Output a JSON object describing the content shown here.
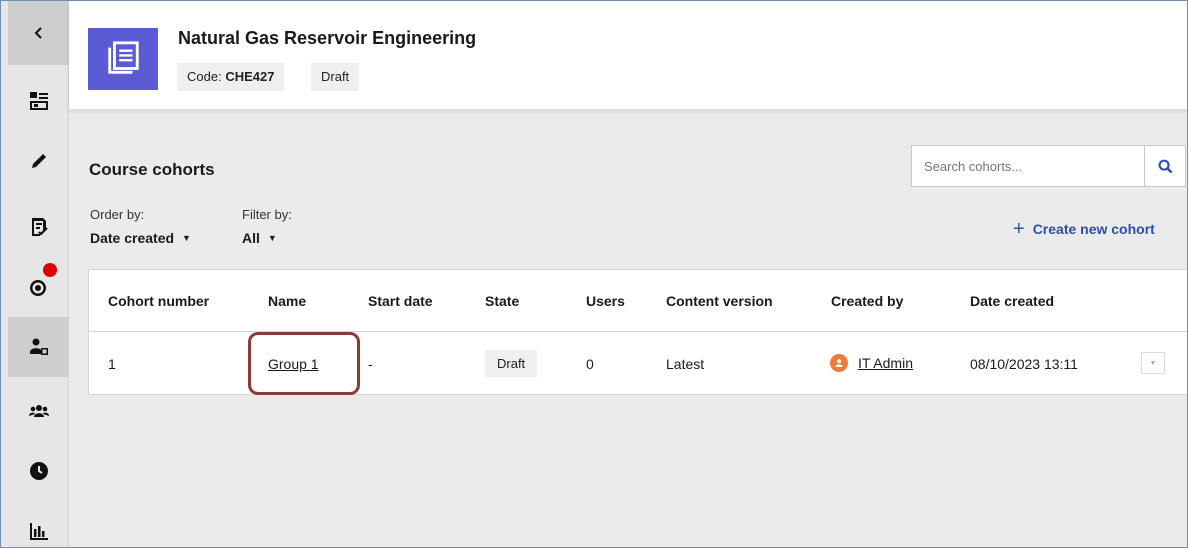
{
  "header": {
    "course_title": "Natural Gas Reservoir Engineering",
    "code_label": "Code: ",
    "code_value": "CHE427",
    "status": "Draft"
  },
  "main": {
    "section_title": "Course cohorts",
    "search": {
      "placeholder": "Search cohorts..."
    },
    "order_by": {
      "label": "Order by:",
      "value": "Date created"
    },
    "filter_by": {
      "label": "Filter by:",
      "value": "All"
    },
    "create_label": "Create new cohort"
  },
  "table": {
    "columns": [
      "Cohort number",
      "Name",
      "Start date",
      "State",
      "Users",
      "Content version",
      "Created by",
      "Date created"
    ],
    "rows": [
      {
        "cohort_number": "1",
        "name": "Group 1",
        "start_date": "-",
        "state": "Draft",
        "users": "0",
        "content_version": "Latest",
        "created_by": "IT Admin",
        "date_created": "08/10/2023 13:11"
      }
    ]
  },
  "colors": {
    "course_icon": "#5b5bd6",
    "notification_dot": "#e00000",
    "link_accent": "#2b4fa8",
    "highlight_border": "#8b3a3a",
    "avatar": "#f07a3a"
  },
  "icons": {
    "sidebar": [
      "chevron-left-icon",
      "dashboard-icon",
      "pencil-icon",
      "checklist-icon",
      "target-icon",
      "cohort-user-icon",
      "group-icon",
      "clock-icon",
      "bar-chart-icon"
    ],
    "header": "course-document-icon",
    "search": "search-icon"
  }
}
